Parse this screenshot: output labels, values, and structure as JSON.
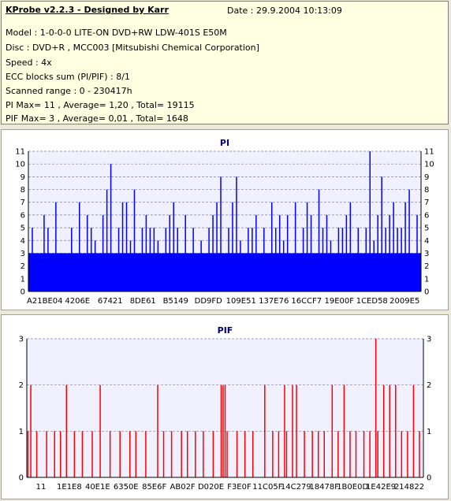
{
  "header": {
    "title": "KProbe v2.2.3 - Designed by Karr",
    "date": "Date : 29.9.2004 10:13:09",
    "lines": [
      "Model : 1-0-0-0 LITE-ON DVD+RW LDW-401S  E50M",
      "Disc : DVD+R , MCC003 [Mitsubishi Chemical Corporation]",
      "Speed : 4x",
      "ECC blocks sum (PI/PIF) : 8/1",
      "Scanned range : 0 - 230417h",
      "PI Max= 11 , Average= 1,20 , Total= 19115",
      "PIF Max= 3 , Average= 0,01 , Total= 1648"
    ]
  },
  "colors": {
    "pi": "#0000ff",
    "pif": "#ff0000",
    "plot_bg": "#f0f0ff",
    "grid": "#8080a0"
  },
  "chart_data": [
    {
      "type": "bar",
      "title": "PI",
      "ylim": [
        0,
        11
      ],
      "yticks": [
        "0",
        "1",
        "2",
        "3",
        "4",
        "5",
        "6",
        "7",
        "8",
        "9",
        "10",
        "11"
      ],
      "xticks": [
        "A21BE04",
        "4206E",
        "67421",
        "8DE61",
        "B5149",
        "DD9FD",
        "109E51",
        "137E76",
        "16CCF7",
        "19E00F",
        "1CED58",
        "2009E5"
      ],
      "grid": true,
      "baseline": 3,
      "spikes": [
        {
          "x": 0.01,
          "y": 5
        },
        {
          "x": 0.04,
          "y": 6
        },
        {
          "x": 0.05,
          "y": 5
        },
        {
          "x": 0.07,
          "y": 7
        },
        {
          "x": 0.11,
          "y": 5
        },
        {
          "x": 0.13,
          "y": 7
        },
        {
          "x": 0.15,
          "y": 6
        },
        {
          "x": 0.16,
          "y": 5
        },
        {
          "x": 0.17,
          "y": 4
        },
        {
          "x": 0.19,
          "y": 6
        },
        {
          "x": 0.21,
          "y": 10
        },
        {
          "x": 0.23,
          "y": 5
        },
        {
          "x": 0.25,
          "y": 7
        },
        {
          "x": 0.26,
          "y": 4
        },
        {
          "x": 0.27,
          "y": 8
        },
        {
          "x": 0.29,
          "y": 5
        },
        {
          "x": 0.3,
          "y": 6
        },
        {
          "x": 0.32,
          "y": 5
        },
        {
          "x": 0.33,
          "y": 4
        },
        {
          "x": 0.35,
          "y": 5
        },
        {
          "x": 0.37,
          "y": 7
        },
        {
          "x": 0.38,
          "y": 5
        },
        {
          "x": 0.4,
          "y": 6
        },
        {
          "x": 0.42,
          "y": 5
        },
        {
          "x": 0.44,
          "y": 4
        },
        {
          "x": 0.46,
          "y": 5
        },
        {
          "x": 0.48,
          "y": 7
        },
        {
          "x": 0.49,
          "y": 9
        },
        {
          "x": 0.51,
          "y": 5
        },
        {
          "x": 0.53,
          "y": 9
        },
        {
          "x": 0.54,
          "y": 4
        },
        {
          "x": 0.56,
          "y": 5
        },
        {
          "x": 0.58,
          "y": 6
        },
        {
          "x": 0.6,
          "y": 5
        },
        {
          "x": 0.62,
          "y": 7
        },
        {
          "x": 0.63,
          "y": 5
        },
        {
          "x": 0.65,
          "y": 4
        },
        {
          "x": 0.66,
          "y": 6
        },
        {
          "x": 0.68,
          "y": 7
        },
        {
          "x": 0.7,
          "y": 5
        },
        {
          "x": 0.72,
          "y": 6
        },
        {
          "x": 0.74,
          "y": 8
        },
        {
          "x": 0.75,
          "y": 5
        },
        {
          "x": 0.77,
          "y": 4
        },
        {
          "x": 0.79,
          "y": 5
        },
        {
          "x": 0.81,
          "y": 6
        },
        {
          "x": 0.82,
          "y": 7
        },
        {
          "x": 0.84,
          "y": 5
        },
        {
          "x": 0.86,
          "y": 5
        },
        {
          "x": 0.88,
          "y": 4
        },
        {
          "x": 0.89,
          "y": 6
        },
        {
          "x": 0.91,
          "y": 5
        },
        {
          "x": 0.93,
          "y": 7
        },
        {
          "x": 0.95,
          "y": 5
        },
        {
          "x": 0.97,
          "y": 8
        },
        {
          "x": 0.99,
          "y": 6
        },
        {
          "x": 0.2,
          "y": 8
        },
        {
          "x": 0.24,
          "y": 7
        },
        {
          "x": 0.31,
          "y": 5
        },
        {
          "x": 0.36,
          "y": 6
        },
        {
          "x": 0.47,
          "y": 6
        },
        {
          "x": 0.52,
          "y": 7
        },
        {
          "x": 0.57,
          "y": 5
        },
        {
          "x": 0.64,
          "y": 6
        },
        {
          "x": 0.71,
          "y": 7
        },
        {
          "x": 0.76,
          "y": 6
        },
        {
          "x": 0.8,
          "y": 5
        },
        {
          "x": 0.87,
          "y": 11
        },
        {
          "x": 0.9,
          "y": 9
        },
        {
          "x": 0.92,
          "y": 6
        },
        {
          "x": 0.94,
          "y": 5
        },
        {
          "x": 0.96,
          "y": 7
        }
      ]
    },
    {
      "type": "bar",
      "title": "PIF",
      "ylim": [
        0,
        3
      ],
      "yticks": [
        "0",
        "1",
        "2",
        "3"
      ],
      "xticks": [
        "11",
        "1E1E8",
        "40E1E",
        "6350E",
        "85E6F",
        "AB02F",
        "D020E",
        "F3E0F",
        "11C05F",
        "14C279",
        "18478F",
        "1B0E0D",
        "1E42E9",
        "214822"
      ],
      "grid": true,
      "spikes": [
        {
          "x": 0.003,
          "y": 1
        },
        {
          "x": 0.01,
          "y": 2
        },
        {
          "x": 0.025,
          "y": 1
        },
        {
          "x": 0.05,
          "y": 1
        },
        {
          "x": 0.07,
          "y": 1
        },
        {
          "x": 0.085,
          "y": 1
        },
        {
          "x": 0.1,
          "y": 2
        },
        {
          "x": 0.12,
          "y": 1
        },
        {
          "x": 0.14,
          "y": 1
        },
        {
          "x": 0.165,
          "y": 1
        },
        {
          "x": 0.185,
          "y": 2
        },
        {
          "x": 0.21,
          "y": 1
        },
        {
          "x": 0.235,
          "y": 1
        },
        {
          "x": 0.26,
          "y": 1
        },
        {
          "x": 0.275,
          "y": 1
        },
        {
          "x": 0.3,
          "y": 1
        },
        {
          "x": 0.33,
          "y": 2
        },
        {
          "x": 0.345,
          "y": 1
        },
        {
          "x": 0.365,
          "y": 1
        },
        {
          "x": 0.39,
          "y": 1
        },
        {
          "x": 0.405,
          "y": 1
        },
        {
          "x": 0.425,
          "y": 1
        },
        {
          "x": 0.445,
          "y": 1
        },
        {
          "x": 0.47,
          "y": 1
        },
        {
          "x": 0.49,
          "y": 2
        },
        {
          "x": 0.495,
          "y": 2
        },
        {
          "x": 0.5,
          "y": 2
        },
        {
          "x": 0.505,
          "y": 1
        },
        {
          "x": 0.53,
          "y": 1
        },
        {
          "x": 0.55,
          "y": 1
        },
        {
          "x": 0.57,
          "y": 1
        },
        {
          "x": 0.6,
          "y": 2
        },
        {
          "x": 0.62,
          "y": 1
        },
        {
          "x": 0.635,
          "y": 1
        },
        {
          "x": 0.65,
          "y": 2
        },
        {
          "x": 0.655,
          "y": 1
        },
        {
          "x": 0.67,
          "y": 2
        },
        {
          "x": 0.68,
          "y": 2
        },
        {
          "x": 0.7,
          "y": 1
        },
        {
          "x": 0.72,
          "y": 1
        },
        {
          "x": 0.735,
          "y": 1
        },
        {
          "x": 0.75,
          "y": 1
        },
        {
          "x": 0.77,
          "y": 2
        },
        {
          "x": 0.785,
          "y": 1
        },
        {
          "x": 0.8,
          "y": 2
        },
        {
          "x": 0.815,
          "y": 1
        },
        {
          "x": 0.83,
          "y": 1
        },
        {
          "x": 0.85,
          "y": 1
        },
        {
          "x": 0.865,
          "y": 1
        },
        {
          "x": 0.88,
          "y": 3
        },
        {
          "x": 0.885,
          "y": 1
        },
        {
          "x": 0.9,
          "y": 2
        },
        {
          "x": 0.915,
          "y": 2
        },
        {
          "x": 0.93,
          "y": 2
        },
        {
          "x": 0.945,
          "y": 1
        },
        {
          "x": 0.96,
          "y": 1
        },
        {
          "x": 0.975,
          "y": 2
        },
        {
          "x": 0.99,
          "y": 1
        }
      ]
    }
  ]
}
